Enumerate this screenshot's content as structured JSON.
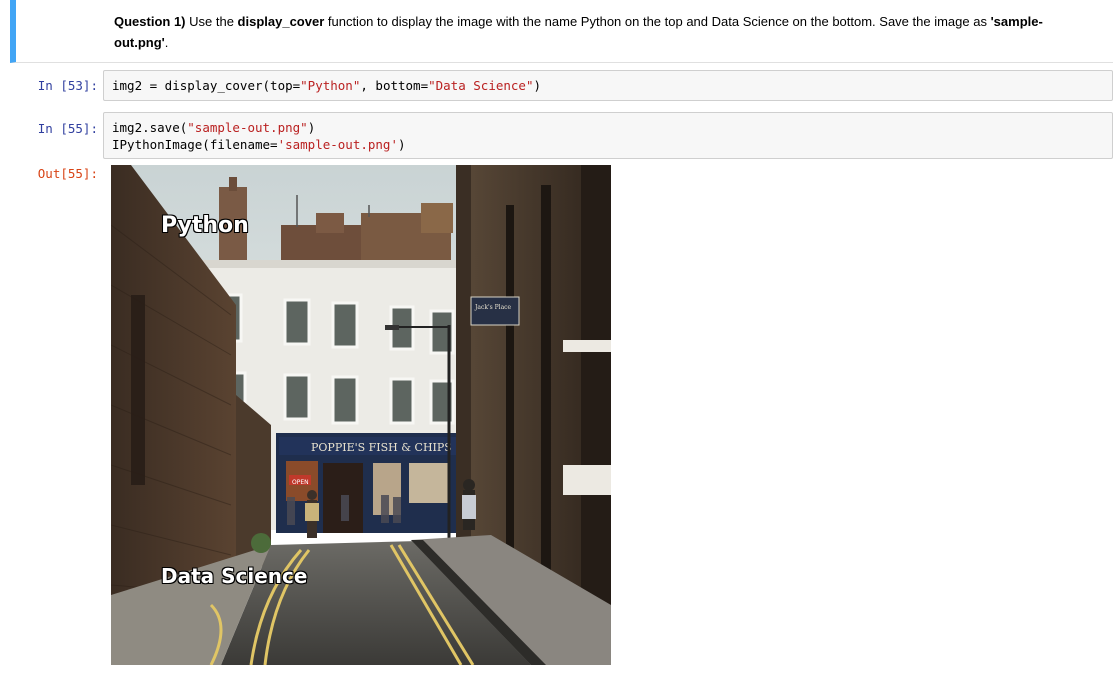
{
  "markdown": {
    "question_label": "Question 1)",
    "text_1": " Use the ",
    "func_name": "display_cover",
    "text_2": " function to display the image with the name Python on the top and Data Science on the bottom. Save the image as ",
    "filename": "'sample-out.png'",
    "text_3": "."
  },
  "cells": [
    {
      "prompt": "In [53]:",
      "code": {
        "a": "img2 = display_cover(top=",
        "s1": "\"Python\"",
        "b": ", bottom=",
        "s2": "\"Data Science\"",
        "c": ")"
      }
    },
    {
      "prompt": "In [55]:",
      "code": {
        "l1a": "img2.save(",
        "l1s": "\"sample-out.png\"",
        "l1b": ")",
        "l2a": "IPythonImage(filename=",
        "l2s": "'sample-out.png'",
        "l2b": ")"
      },
      "out_prompt": "Out[55]:"
    }
  ],
  "image": {
    "top_text": "Python",
    "bottom_text": "Data Science",
    "shop_sign": "POPPIE'S   FISH & CHIPS",
    "small_sign": "Jack's Place",
    "open_sign": "OPEN"
  },
  "colors": {
    "cell_border": "#42a5f5",
    "in_prompt": "#303f9f",
    "out_prompt": "#d84315",
    "string": "#ba2121"
  }
}
